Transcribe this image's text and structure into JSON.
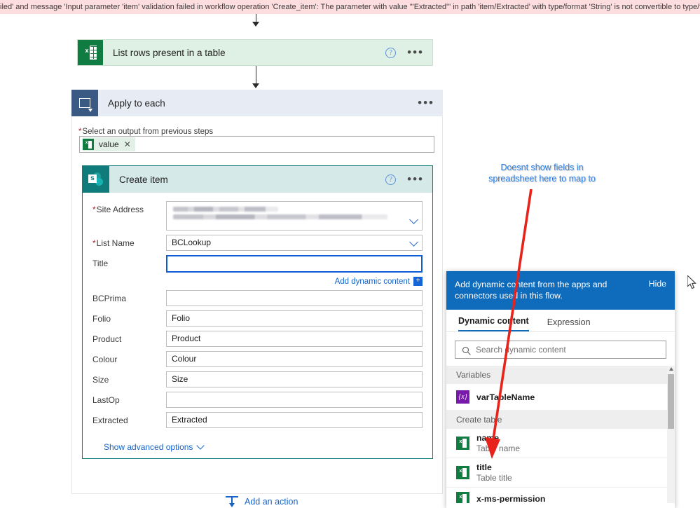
{
  "error_banner": {
    "text": "iled' and message 'Input parameter 'item' validation failed in workflow operation 'Create_item': The parameter with value '\"Extracted\"' in path 'item/Extracted' with type/format 'String' is not convertible to type/format 'String/da"
  },
  "flow": {
    "excel_action": {
      "title": "List rows present in a table",
      "icon": "excel-icon",
      "help_icon": "?",
      "more_icon": "•••"
    },
    "apply_to_each": {
      "title": "Apply to each",
      "icon": "loop-icon",
      "more_icon": "•••",
      "output_label": "Select an output from previous steps",
      "output_required": "*",
      "token": {
        "label": "value",
        "remove": "✕",
        "icon": "excel-icon"
      }
    },
    "create_item": {
      "title": "Create item",
      "icon": "sharepoint-icon",
      "help_icon": "?",
      "more_icon": "•••",
      "fields": [
        {
          "label": "Site Address",
          "required": true,
          "value": "",
          "type": "dropdown-blurred"
        },
        {
          "label": "List Name",
          "required": true,
          "value": "BCLookup",
          "type": "dropdown"
        },
        {
          "label": "Title",
          "required": false,
          "value": "",
          "type": "text-focused"
        },
        {
          "label": "BCPrima",
          "required": false,
          "value": "",
          "type": "text"
        },
        {
          "label": "Folio",
          "required": false,
          "value": "Folio",
          "type": "text"
        },
        {
          "label": "Product",
          "required": false,
          "value": "Product",
          "type": "text"
        },
        {
          "label": "Colour",
          "required": false,
          "value": "Colour",
          "type": "text"
        },
        {
          "label": "Size",
          "required": false,
          "value": "Size",
          "type": "text"
        },
        {
          "label": "LastOp",
          "required": false,
          "value": "",
          "type": "text"
        },
        {
          "label": "Extracted",
          "required": false,
          "value": "Extracted",
          "type": "text"
        }
      ],
      "add_dynamic_content": "Add dynamic content",
      "add_dynamic_plus": "+",
      "show_advanced": "Show advanced options"
    },
    "add_an_action": "Add an action"
  },
  "dynamic_panel": {
    "header_text": "Add dynamic content from the apps and connectors used in this flow.",
    "hide_label": "Hide",
    "tabs": [
      {
        "label": "Dynamic content",
        "active": true
      },
      {
        "label": "Expression",
        "active": false
      }
    ],
    "search_placeholder": "Search dynamic content",
    "search_value": "",
    "search_icon": "search-icon",
    "groups": [
      {
        "name": "Variables",
        "items": [
          {
            "name": "varTableName",
            "desc": "",
            "icon": "variable-icon"
          }
        ]
      },
      {
        "name": "Create table",
        "items": [
          {
            "name": "name",
            "desc": "Table name",
            "icon": "excel-icon"
          },
          {
            "name": "title",
            "desc": "Table title",
            "icon": "excel-icon"
          },
          {
            "name": "x-ms-permission",
            "desc": "",
            "icon": "excel-icon"
          }
        ]
      }
    ]
  },
  "annotation": {
    "text": "Doesnt show fields in spreadsheet here to map to",
    "color": "#2f7fe0",
    "arrow_color": "#e8231c"
  },
  "colors": {
    "excel_green": "#107c41",
    "sharepoint_teal": "#0f7b7b",
    "apply_blue": "#3a5a84",
    "panel_blue": "#0f6cbd",
    "link_blue": "#1563c7",
    "error_pink": "#fdddde",
    "focus_blue": "#0b5cd5"
  }
}
